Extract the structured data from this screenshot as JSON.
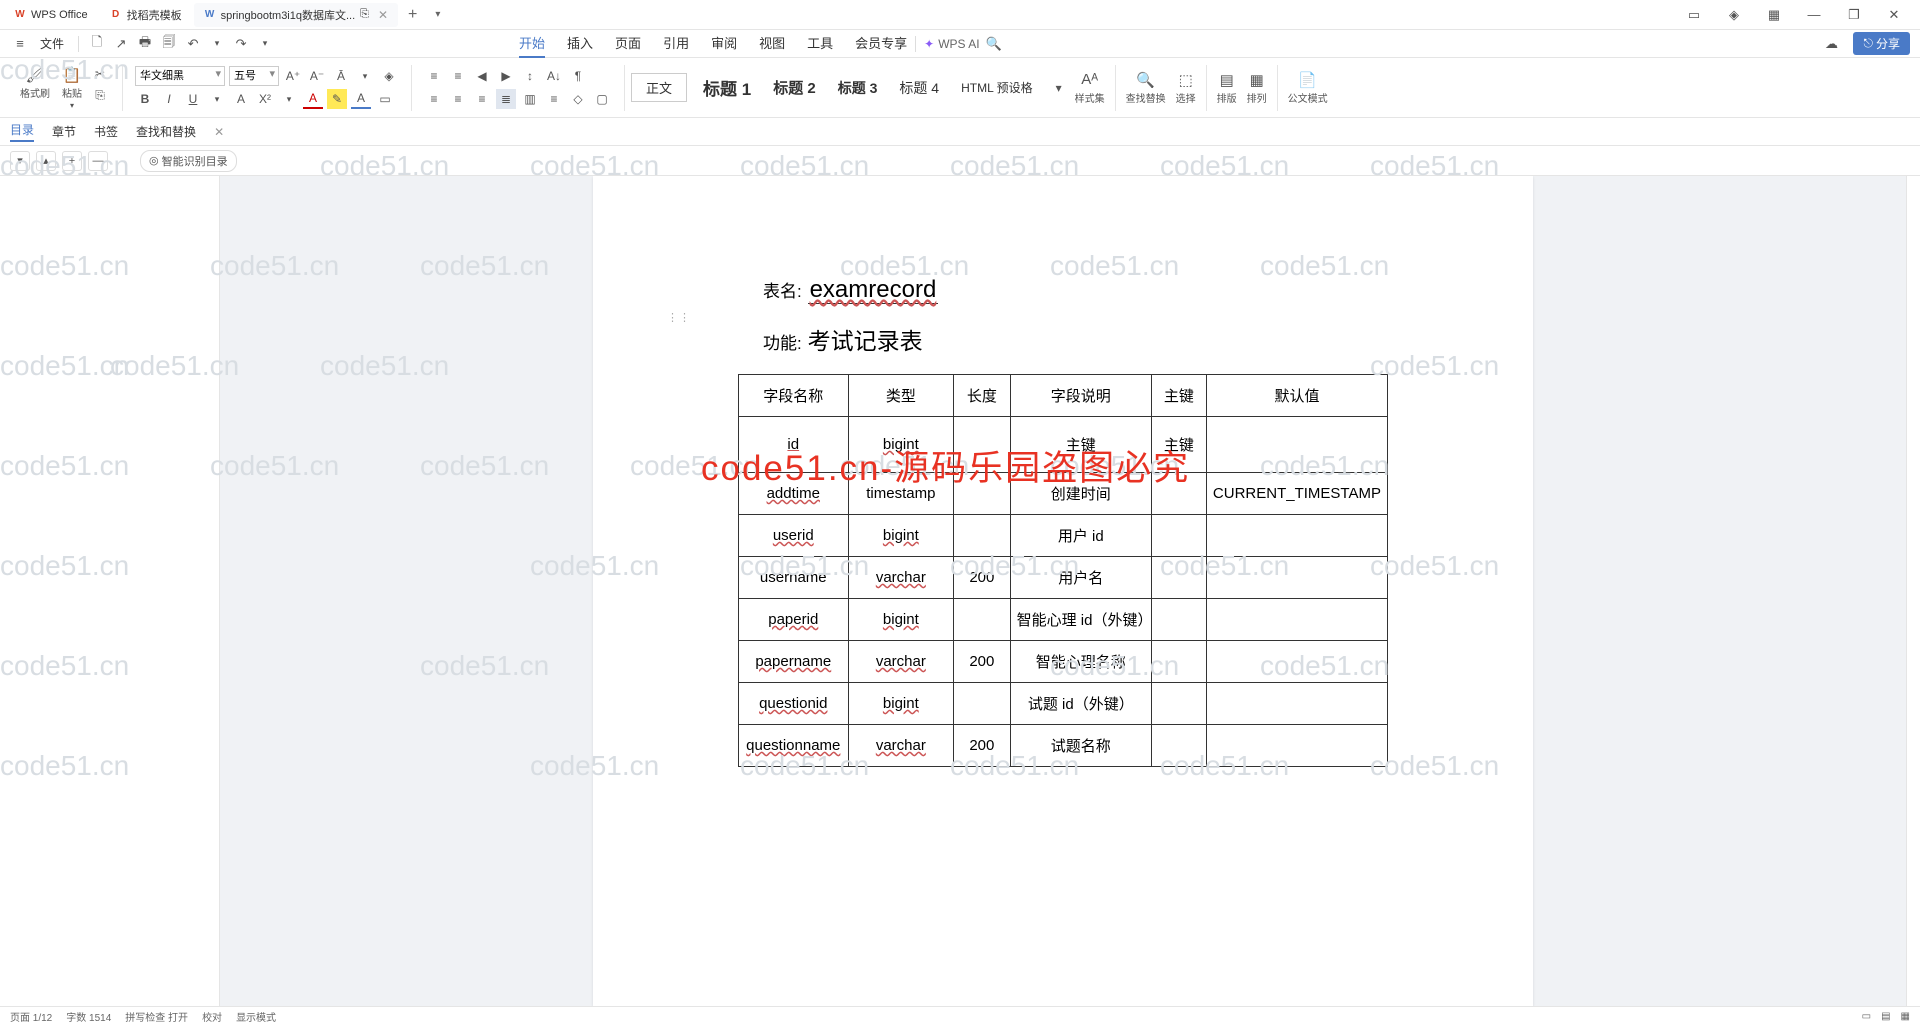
{
  "titlebar": {
    "tabs": [
      {
        "icon": "W",
        "label": "WPS Office",
        "iconClass": "wps-ico"
      },
      {
        "icon": "D",
        "label": "找稻壳模板",
        "iconClass": "red-ico"
      },
      {
        "icon": "W",
        "label": "springbootm3i1q数据库文...",
        "iconClass": "blue-ico",
        "active": true
      }
    ],
    "add": "+",
    "more": "▾"
  },
  "winbtns": {
    "b1": "▭",
    "b2": "◈",
    "b3": "▦",
    "min": "—",
    "max": "❐",
    "close": "✕"
  },
  "menu": {
    "hamburger": "≡",
    "file": "文件",
    "quick": [
      "🗋",
      "↗",
      "🖶",
      "🗐",
      "↶",
      "▾",
      "↷",
      "▾"
    ],
    "tabs": [
      "开始",
      "插入",
      "页面",
      "引用",
      "审阅",
      "视图",
      "工具",
      "会员专享"
    ],
    "active": "开始",
    "wpsai": "WPS AI",
    "search": "🔍",
    "cloud": "☁",
    "share": "分享"
  },
  "ribbon": {
    "format_brush": "格式刷",
    "paste": "粘贴",
    "cut": "✂",
    "font": "华文细黑",
    "size": "五号",
    "format_icons": [
      "A⁺",
      "A⁻",
      "Ā",
      "▾",
      "◈"
    ],
    "bold": "B",
    "italic": "I",
    "underline": "U",
    "more_u": "▾",
    "strike": "A",
    "sup": "X²",
    "sub": "▾",
    "fcolor": "A",
    "hl": "✎",
    "hl2": "A",
    "border": "▭",
    "list1": "≡",
    "list2": "≡",
    "indent1": "◀",
    "indent2": "▶",
    "spacing": "↕",
    "sort": "A↓",
    "para": "¶",
    "align": [
      "≡",
      "≡",
      "≡",
      "≣"
    ],
    "cols": "▥",
    "line": "≡",
    "fill": "◇",
    "brd": "▢",
    "styles": {
      "body": "正文",
      "h1": "标题 1",
      "h2": "标题 2",
      "h3": "标题 3",
      "h4": "标题 4",
      "html": "HTML 预设格",
      "more": "▾"
    },
    "style_set": "样式集",
    "find": "查找替换",
    "select": "选择",
    "layout": "排版",
    "arrange": "排列",
    "official": "公文模式"
  },
  "nav": {
    "items": [
      "目录",
      "章节",
      "书签",
      "查找和替换"
    ],
    "active": "目录",
    "close": "✕"
  },
  "tb2": {
    "b1": "▾",
    "b2": "▴",
    "b3": "+",
    "b4": "—",
    "smart_icon": "◎",
    "smart": "智能识别目录"
  },
  "document": {
    "table_name_label": "表名:",
    "table_name": "examrecord",
    "function_label": "功能:",
    "function": "考试记录表",
    "headers": [
      "字段名称",
      "类型",
      "长度",
      "字段说明",
      "主键",
      "默认值"
    ],
    "rows": [
      {
        "c1": "id",
        "c2": "bigint",
        "c3": "",
        "c4": "主键",
        "c5": "主键",
        "c6": ""
      },
      {
        "c1": "addtime",
        "c2": "timestamp",
        "c3": "",
        "c4": "创建时间",
        "c5": "",
        "c6": "CURRENT_TIMESTAMP"
      },
      {
        "c1": "userid",
        "c2": "bigint",
        "c3": "",
        "c4": "用户 id",
        "c5": "",
        "c6": ""
      },
      {
        "c1": "username",
        "c2": "varchar",
        "c3": "200",
        "c4": "用户名",
        "c5": "",
        "c6": ""
      },
      {
        "c1": "paperid",
        "c2": "bigint",
        "c3": "",
        "c4": "智能心理 id（外键）",
        "c5": "",
        "c6": ""
      },
      {
        "c1": "papername",
        "c2": "varchar",
        "c3": "200",
        "c4": "智能心理名称",
        "c5": "",
        "c6": ""
      },
      {
        "c1": "questionid",
        "c2": "bigint",
        "c3": "",
        "c4": "试题 id（外键）",
        "c5": "",
        "c6": ""
      },
      {
        "c1": "questionname",
        "c2": "varchar",
        "c3": "200",
        "c4": "试题名称",
        "c5": "",
        "c6": ""
      }
    ]
  },
  "overlay": "code51.cn-源码乐园盗图必究",
  "watermark": "code51.cn",
  "statusbar": {
    "page": "页面 1/12",
    "words": "字数 1514",
    "spell": "拼写检查 打开",
    "proof": "校对",
    "mode": "显示模式"
  }
}
